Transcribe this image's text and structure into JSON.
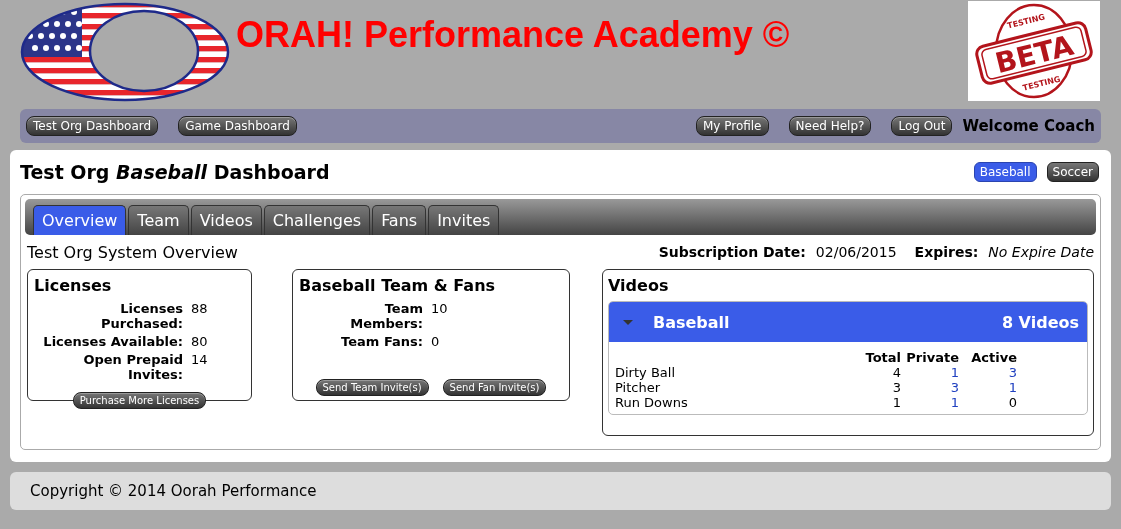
{
  "header": {
    "title": "ORAH! Performance Academy ©",
    "beta_badge": {
      "top": "TESTING",
      "main": "BETA",
      "bottom": "TESTING"
    }
  },
  "nav": {
    "left": [
      "Test Org Dashboard",
      "Game Dashboard"
    ],
    "right": [
      "My Profile",
      "Need Help?",
      "Log Out"
    ],
    "welcome": "Welcome Coach"
  },
  "dashboard": {
    "heading": "Test Org *Baseball* Dashboard",
    "sports": [
      {
        "label": "Baseball",
        "selected": true
      },
      {
        "label": "Soccer",
        "selected": false
      }
    ],
    "tabs": [
      {
        "label": "Overview",
        "selected": true
      },
      {
        "label": "Team",
        "selected": false
      },
      {
        "label": "Videos",
        "selected": false
      },
      {
        "label": "Challenges",
        "selected": false
      },
      {
        "label": "Fans",
        "selected": false
      },
      {
        "label": "Invites",
        "selected": false
      }
    ],
    "overview_title": "Test Org System Overview",
    "subscription": {
      "label": "Subscription Date:",
      "value": "02/06/2015",
      "expires_label": "Expires:",
      "expires_value": "No Expire Date"
    },
    "licenses": {
      "title": "Licenses",
      "rows": [
        {
          "label": "Licenses Purchased:",
          "value": "88"
        },
        {
          "label": "Licenses Available:",
          "value": "80"
        },
        {
          "label": "Open Prepaid Invites:",
          "value": "14"
        }
      ],
      "buttons": [
        "Purchase More Licenses"
      ]
    },
    "team_fans": {
      "title": "Baseball Team & Fans",
      "rows": [
        {
          "label": "Team Members:",
          "value": "10"
        },
        {
          "label": "Team Fans:",
          "value": "0"
        }
      ],
      "buttons": [
        "Send Team Invite(s)",
        "Send Fan Invite(s)"
      ]
    },
    "videos": {
      "title": "Videos",
      "group": {
        "name": "Baseball",
        "count": "8 Videos",
        "expanded": true
      },
      "columns": [
        "Total",
        "Private",
        "Active"
      ],
      "rows": [
        {
          "name": "Dirty Ball",
          "cells": [
            {
              "text": "4",
              "link": false
            },
            {
              "text": "1",
              "link": true
            },
            {
              "text": "3",
              "link": true
            }
          ]
        },
        {
          "name": "Pitcher",
          "cells": [
            {
              "text": "3",
              "link": false
            },
            {
              "text": "3",
              "link": true
            },
            {
              "text": "1",
              "link": true
            }
          ]
        },
        {
          "name": "Run Downs",
          "cells": [
            {
              "text": "1",
              "link": false
            },
            {
              "text": "1",
              "link": true
            },
            {
              "text": "0",
              "link": false
            }
          ]
        }
      ]
    }
  },
  "footer": "Copyright © 2014 Oorah Performance"
}
